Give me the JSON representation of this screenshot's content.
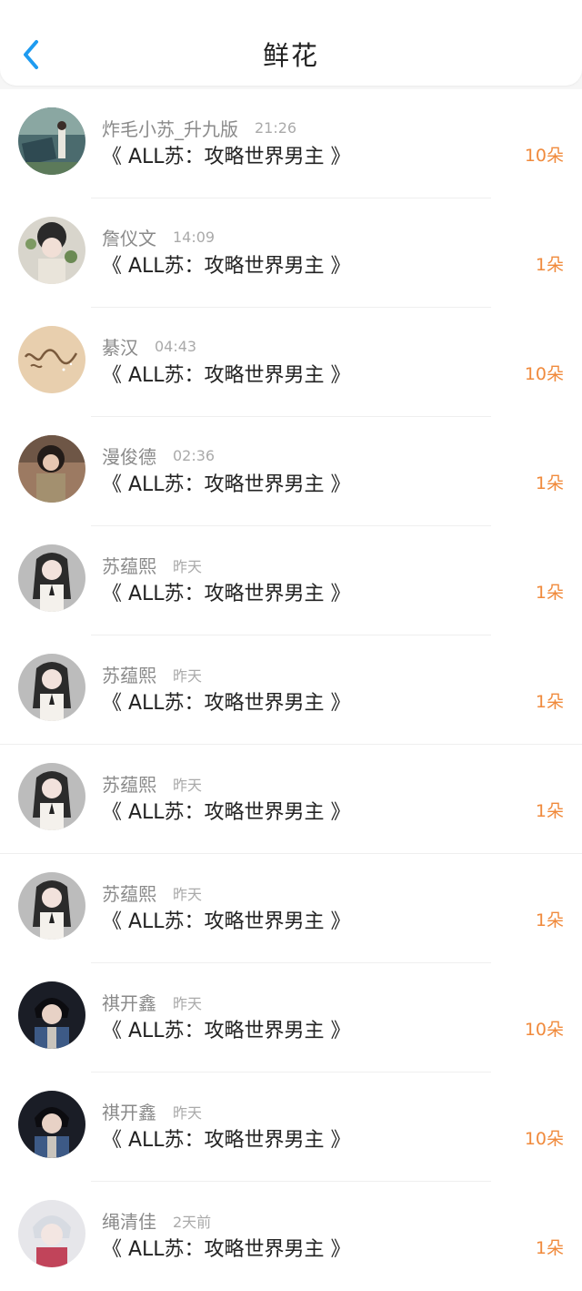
{
  "header": {
    "title": "鲜花",
    "back_icon": "chevron-left-icon",
    "accent_color": "#1e9bf0"
  },
  "colors": {
    "count": "#f08a3c",
    "name": "#8a8a8a",
    "time": "#aaaaaa",
    "book": "#222222"
  },
  "items": [
    {
      "name": "炸毛小苏_升九版",
      "time": "21:26",
      "book": "《 ALL苏：攻略世界男主 》",
      "count": "10朵"
    },
    {
      "name": "詹仪文",
      "time": "14:09",
      "book": "《 ALL苏：攻略世界男主 》",
      "count": "1朵"
    },
    {
      "name": "綦汉",
      "time": "04:43",
      "book": "《 ALL苏：攻略世界男主 》",
      "count": "10朵"
    },
    {
      "name": "漫俊德",
      "time": "02:36",
      "book": "《 ALL苏：攻略世界男主 》",
      "count": "1朵"
    },
    {
      "name": "苏蕴熙",
      "time": "昨天",
      "book": "《 ALL苏：攻略世界男主 》",
      "count": "1朵"
    },
    {
      "name": "苏蕴熙",
      "time": "昨天",
      "book": "《 ALL苏：攻略世界男主 》",
      "count": "1朵"
    },
    {
      "name": "苏蕴熙",
      "time": "昨天",
      "book": "《 ALL苏：攻略世界男主 》",
      "count": "1朵"
    },
    {
      "name": "苏蕴熙",
      "time": "昨天",
      "book": "《 ALL苏：攻略世界男主 》",
      "count": "1朵"
    },
    {
      "name": "祺开鑫",
      "time": "昨天",
      "book": "《 ALL苏：攻略世界男主 》",
      "count": "10朵"
    },
    {
      "name": "祺开鑫",
      "time": "昨天",
      "book": "《 ALL苏：攻略世界男主 》",
      "count": "10朵"
    },
    {
      "name": "绳清佳",
      "time": "2天前",
      "book": "《 ALL苏：攻略世界男主 》",
      "count": "1朵"
    }
  ]
}
